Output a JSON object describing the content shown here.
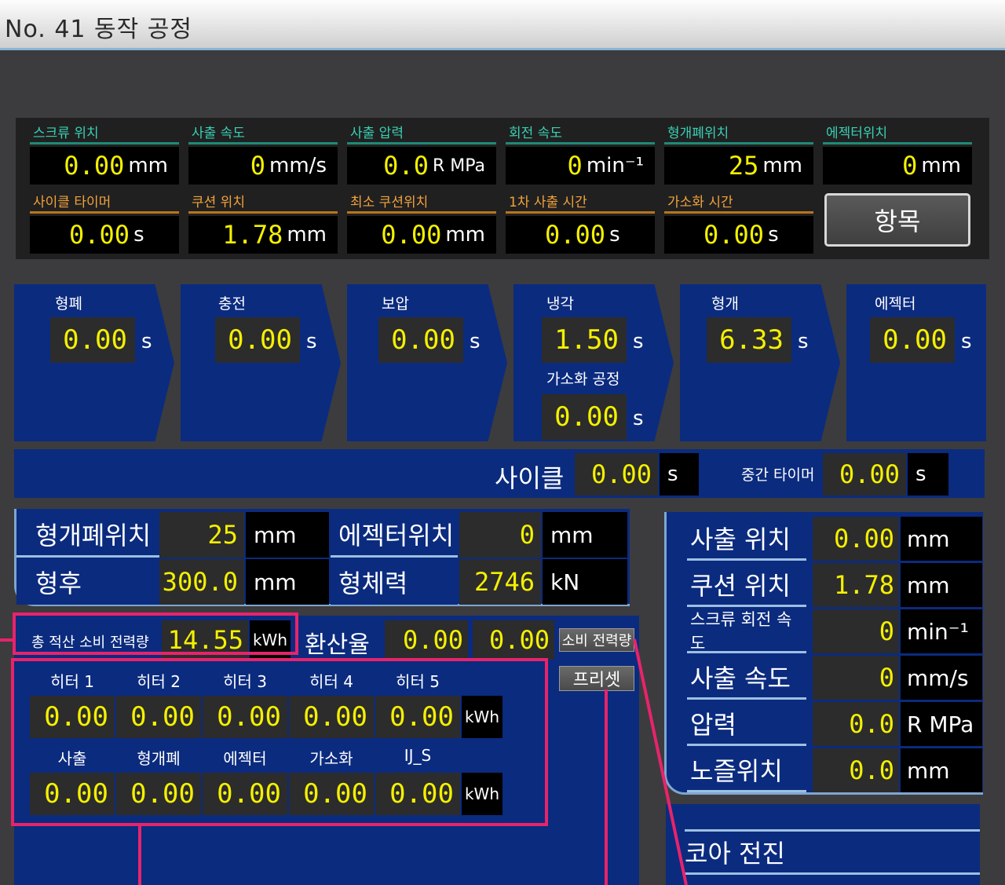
{
  "title": "No. 41  동작 공정",
  "monitor": {
    "row1": [
      {
        "label": "스크류 위치",
        "value": "0.00",
        "unit": "mm"
      },
      {
        "label": "사출 속도",
        "value": "0",
        "unit": "mm/s"
      },
      {
        "label": "사출 압력",
        "value": "0.0",
        "unit": "R MPa"
      },
      {
        "label": "회전 속도",
        "value": "0",
        "unit": "min⁻¹"
      },
      {
        "label": "형개폐위치",
        "value": "25",
        "unit": "mm"
      },
      {
        "label": "에젝터위치",
        "value": "0",
        "unit": "mm"
      }
    ],
    "row2": [
      {
        "label": "사이클 타이머",
        "value": "0.00",
        "unit": "s"
      },
      {
        "label": "쿠션 위치",
        "value": "1.78",
        "unit": "mm"
      },
      {
        "label": "최소 쿠션위치",
        "value": "0.00",
        "unit": "mm"
      },
      {
        "label": "1차 사출 시간",
        "value": "0.00",
        "unit": "s"
      },
      {
        "label": "가소화 시간",
        "value": "0.00",
        "unit": "s"
      }
    ],
    "item_button": "항목"
  },
  "steps": [
    {
      "label": "형폐",
      "value": "0.00",
      "unit": "s"
    },
    {
      "label": "충전",
      "value": "0.00",
      "unit": "s"
    },
    {
      "label": "보압",
      "value": "0.00",
      "unit": "s"
    },
    {
      "label": "냉각",
      "value": "1.50",
      "unit": "s",
      "sub_label": "가소화 공정",
      "sub_value": "0.00",
      "sub_unit": "s"
    },
    {
      "label": "형개",
      "value": "6.33",
      "unit": "s"
    },
    {
      "label": "에젝터",
      "value": "0.00",
      "unit": "s"
    }
  ],
  "cycle": {
    "label": "사이클",
    "value": "0.00",
    "unit": "s",
    "timer_label": "중간 타이머",
    "timer_value": "0.00",
    "timer_unit": "s"
  },
  "mold": {
    "open_pos_label": "형개폐위치",
    "open_pos_value": "25",
    "open_pos_unit": "mm",
    "ejector_label": "에젝터위치",
    "ejector_value": "0",
    "ejector_unit": "mm",
    "thickness_label": "형후",
    "thickness_value": "300.0",
    "thickness_unit": "mm",
    "clamp_label": "형체력",
    "clamp_value": "2746",
    "clamp_unit": "kN"
  },
  "right": [
    {
      "label": "사출 위치",
      "value": "0.00",
      "unit": "mm"
    },
    {
      "label": "쿠션 위치",
      "value": "1.78",
      "unit": "mm"
    },
    {
      "label": "스크류 회전 속도",
      "value": "0",
      "unit": "min⁻¹"
    },
    {
      "label": "사출 속도",
      "value": "0",
      "unit": "mm/s"
    },
    {
      "label": "압력",
      "value": "0.0",
      "unit": "R MPa"
    },
    {
      "label": "노즐위치",
      "value": "0.0",
      "unit": "mm"
    }
  ],
  "core": {
    "label": "코아 전진"
  },
  "energy": {
    "total_label": "총 적산 소비 전력량",
    "total_value": "14.55",
    "total_unit": "kWh",
    "rate_label": "환산율",
    "rate_value": "0.00",
    "rate_value2": "0.00",
    "consume_button": "소비 전력량",
    "preset_button": "프리셋",
    "heaters": [
      {
        "label": "히터 1",
        "value": "0.00"
      },
      {
        "label": "히터 2",
        "value": "0.00"
      },
      {
        "label": "히터 3",
        "value": "0.00"
      },
      {
        "label": "히터 4",
        "value": "0.00"
      },
      {
        "label": "히터 5",
        "value": "0.00"
      }
    ],
    "heaters_unit": "kWh",
    "motors": [
      {
        "label": "사출",
        "value": "0.00"
      },
      {
        "label": "형개폐",
        "value": "0.00"
      },
      {
        "label": "에젝터",
        "value": "0.00"
      },
      {
        "label": "가소화",
        "value": "0.00"
      },
      {
        "label": "IJ_S",
        "value": "0.00"
      }
    ],
    "motors_unit": "kWh"
  },
  "colors": {
    "panel_blue": "#0b2b7f",
    "value_yellow": "#f4f000",
    "highlight": "#e8236b",
    "label_green": "#39d0b4",
    "label_orange": "#f2a23b"
  }
}
